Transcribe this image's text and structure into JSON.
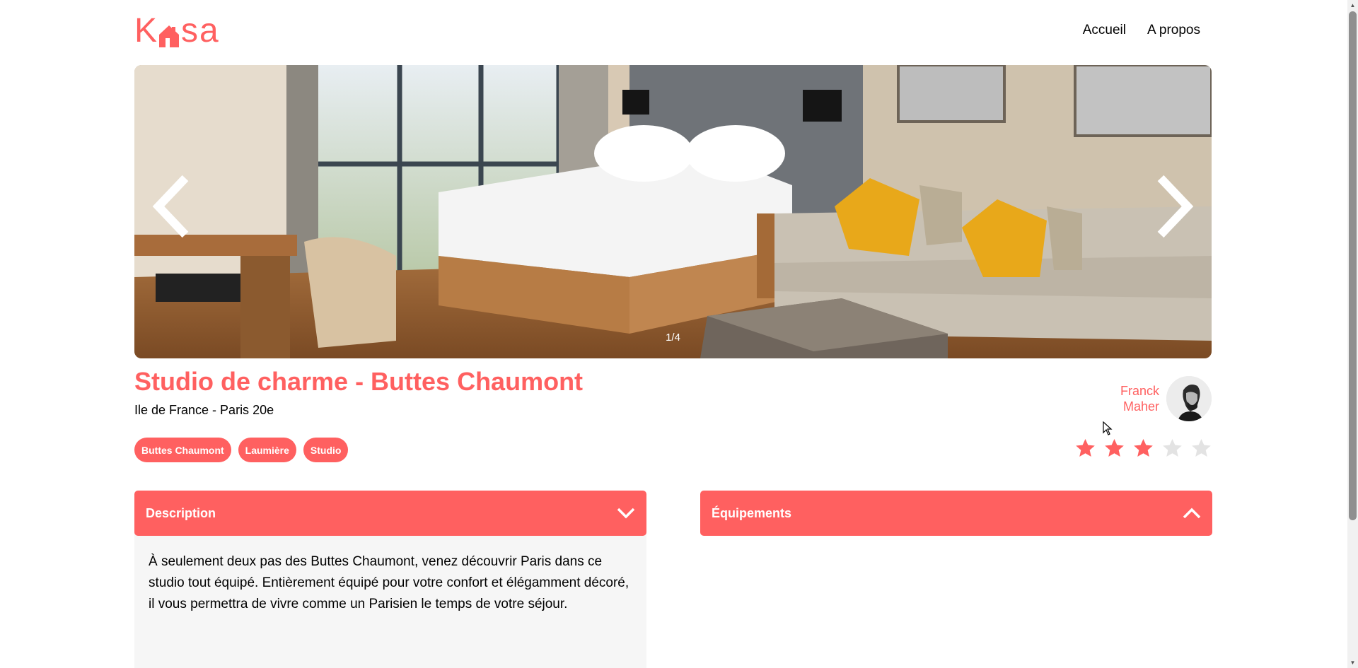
{
  "logo": {
    "text_left": "K",
    "text_right": "sa",
    "icon": "house-icon"
  },
  "nav": {
    "items": [
      {
        "label": "Accueil"
      },
      {
        "label": "A propos"
      }
    ]
  },
  "carousel": {
    "counter": "1/4",
    "prev_icon": "chevron-left-icon",
    "next_icon": "chevron-right-icon",
    "image": "hotel-room-photo"
  },
  "listing": {
    "title": "Studio de charme - Buttes Chaumont",
    "location": "Ile de France - Paris 20e",
    "tags": [
      "Buttes Chaumont",
      "Laumière",
      "Studio"
    ]
  },
  "host": {
    "first_name": "Franck",
    "last_name": "Maher"
  },
  "rating": {
    "value": 3,
    "max": 5,
    "active_color": "#FF6060",
    "inactive_color": "#E3E3E3"
  },
  "collapses": {
    "description": {
      "title": "Description",
      "open": true,
      "icon": "chevron-down-icon",
      "text": "À seulement deux pas des Buttes Chaumont, venez découvrir Paris dans ce studio tout équipé. Entièrement équipé pour votre confort et élégamment décoré, il vous permettra de vivre comme un Parisien le temps de votre séjour."
    },
    "equipments": {
      "title": "Équipements",
      "open": false,
      "icon": "chevron-up-icon"
    }
  },
  "colors": {
    "accent": "#FF6060",
    "panel": "#F6F6F6"
  }
}
